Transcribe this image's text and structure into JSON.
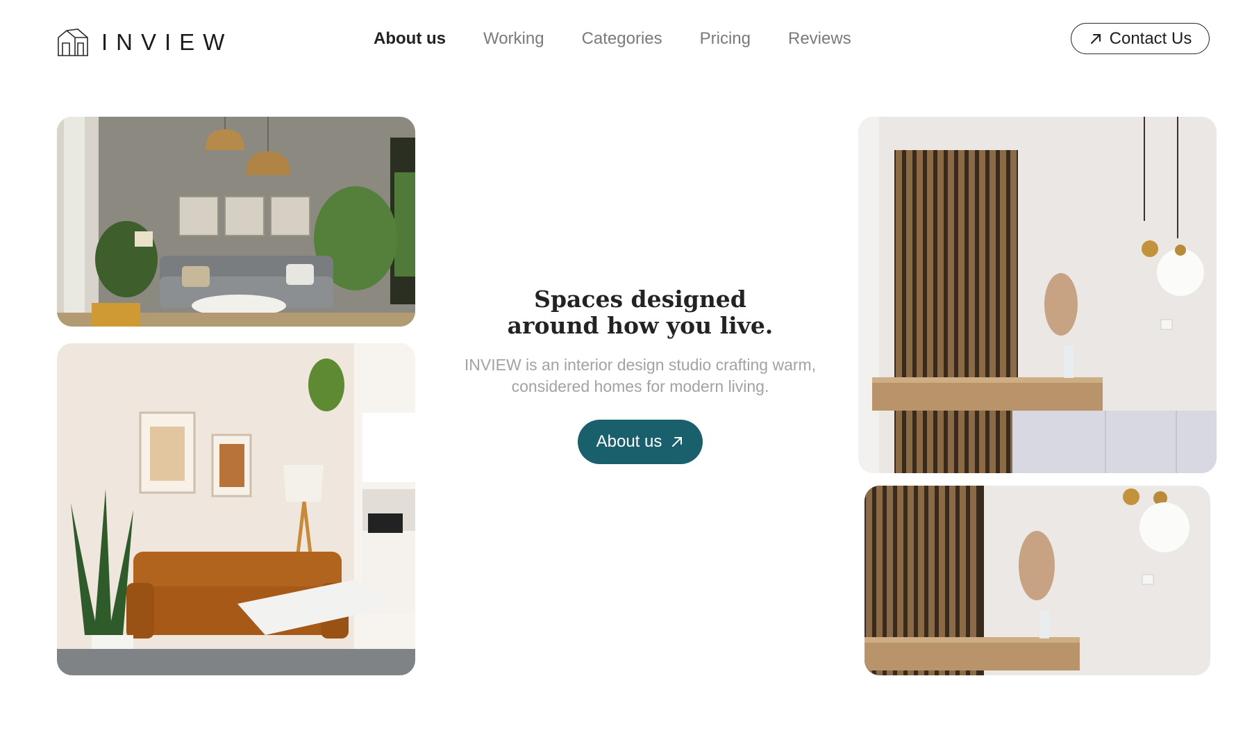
{
  "brand": {
    "name": "INVIEW"
  },
  "nav": {
    "items": [
      {
        "label": "About us",
        "active": true
      },
      {
        "label": "Working",
        "active": false
      },
      {
        "label": "Categories",
        "active": false
      },
      {
        "label": "Pricing",
        "active": false
      },
      {
        "label": "Reviews",
        "active": false
      }
    ]
  },
  "header": {
    "contact_label": "Contact Us"
  },
  "hero": {
    "title_line1": "Spaces designed",
    "title_line2": "around how you live.",
    "subtitle_line1": "INVIEW is an interior design studio crafting warm,",
    "subtitle_line2": "considered homes for modern living.",
    "cta_label": "About us"
  },
  "icons": {
    "logo": "house-outline-icon",
    "contact_arrow": "arrow-up-right-icon",
    "cta_arrow": "arrow-up-right-icon"
  },
  "colors": {
    "accent": "#1a5f6c",
    "nav_active": "#222222",
    "nav_inactive": "#7a7a7a",
    "subtitle": "#a2a2a2"
  }
}
